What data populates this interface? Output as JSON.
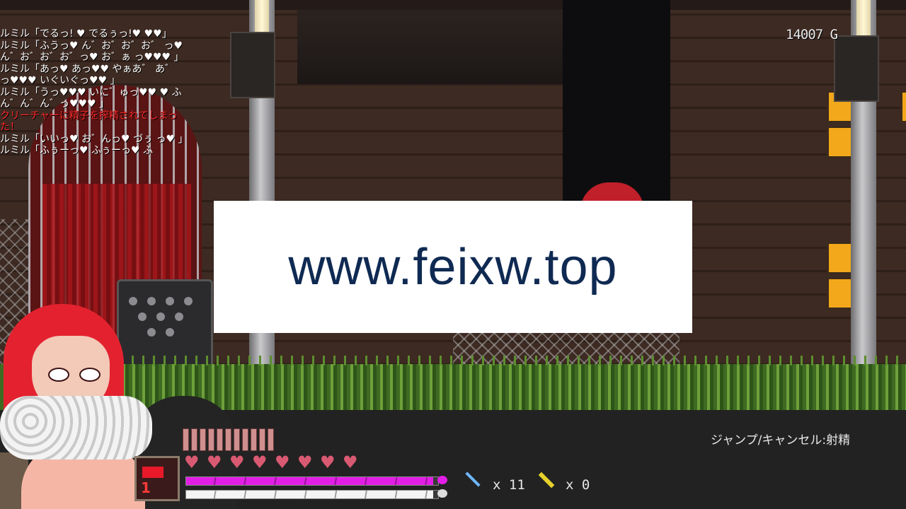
{
  "log": [
    {
      "text": "ルミル「でるっ! ♥ でるぅっ!♥ ♥♥」",
      "kind": "speech"
    },
    {
      "text": "ルミル「ふうっ♥ ん゛お゛お゛お゛ っ♥ ん゛お゛お゛お゛っ♥ お゛ぁ っ♥♥♥ 」",
      "kind": "speech"
    },
    {
      "text": "ルミル「あっ♥ あっ♥♥ やぁあ゛ あ゛っ♥♥♥ いぐいぐっ♥♥ 」",
      "kind": "speech"
    },
    {
      "text": "ルミル「うっ♥♥♥ いに゛ゅっ♥♥ ♥ ふん゛ん゛ん゛っ♥♥♥ 」",
      "kind": "speech"
    },
    {
      "text": "クリーチャーに精子を搾精されてしまった！",
      "kind": "system"
    },
    {
      "text": "ルミル「いいっ♥ お゛んっ♥ づぅ っ♥ 」",
      "kind": "speech"
    },
    {
      "text": "ルミル「ふぅーっ♥ ふぅーっ♥ ふ",
      "kind": "speech"
    }
  ],
  "gold": "14007 G",
  "watermark": "www.feixw.top",
  "hud": {
    "skill_level": "1",
    "stamina_segments": 11,
    "hearts": 8,
    "pink_bar_fraction": 0.98,
    "white_bar_fraction": 0.98,
    "item1_icon": "dagger-icon",
    "item1_count": "x 11",
    "item2_icon": "key-icon",
    "item2_count": "x 0",
    "hint": "ジャンプ/キャンセル:射精"
  },
  "colors": {
    "pink_bar": "#e21ee6",
    "white_bar": "#f4f4f4",
    "heart": "#d85a72",
    "system_text": "#ff2a2a",
    "hud_bg": "#222222"
  }
}
